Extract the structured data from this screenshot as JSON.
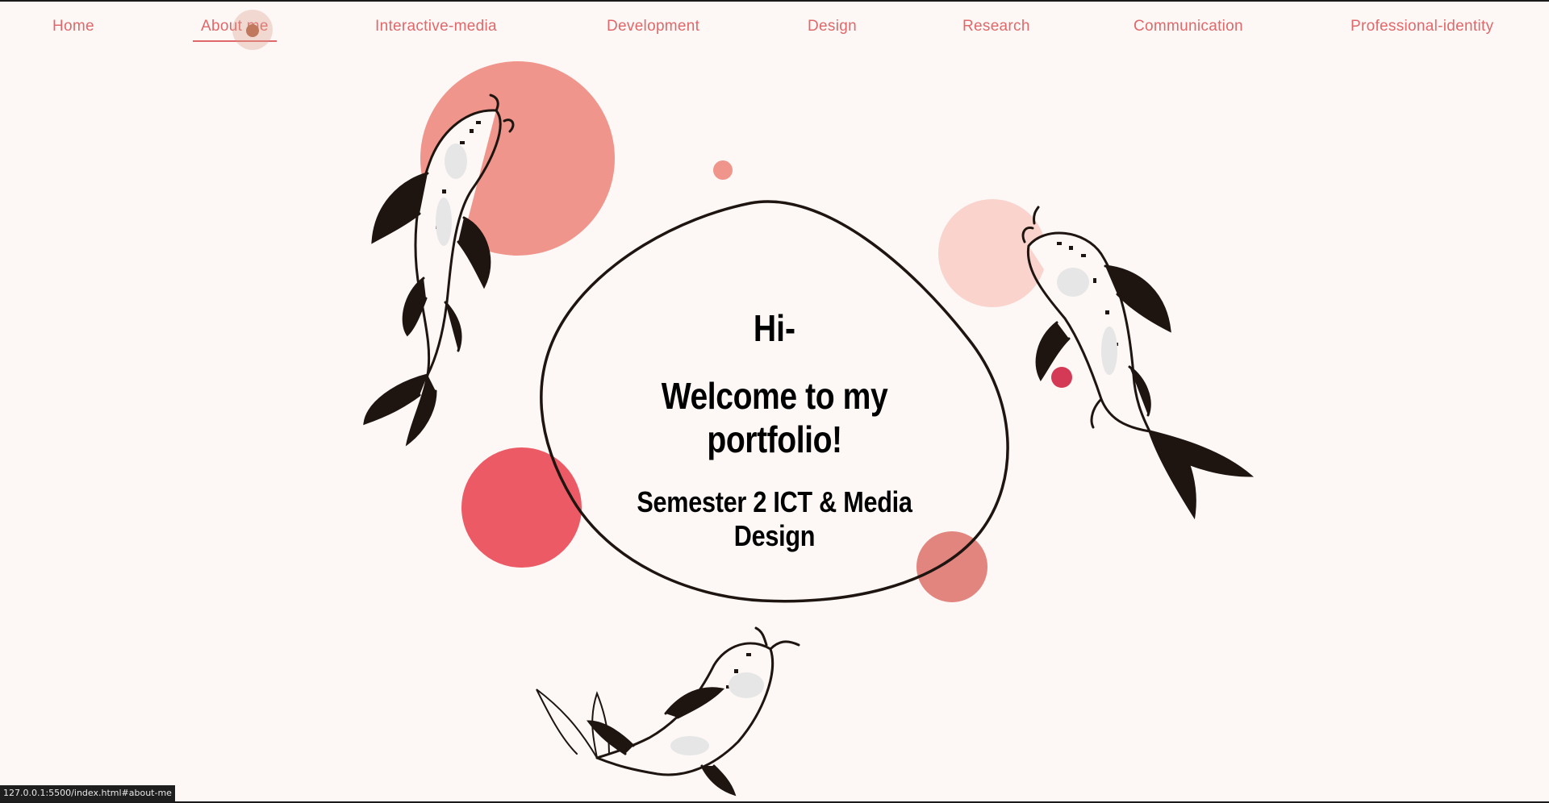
{
  "nav": {
    "items": [
      {
        "label": "Home"
      },
      {
        "label": "About me",
        "active": true
      },
      {
        "label": "Interactive-media"
      },
      {
        "label": "Development"
      },
      {
        "label": "Design"
      },
      {
        "label": "Research"
      },
      {
        "label": "Communication"
      },
      {
        "label": "Professional-identity"
      }
    ]
  },
  "hero": {
    "greeting": "Hi-",
    "welcome": "Welcome to my portfolio!",
    "subtitle": "Semester 2 ICT & Media Design"
  },
  "status_bar": {
    "url": "127.0.0.1:5500/index.html#about-me"
  },
  "colors": {
    "background": "#fdf8f6",
    "nav_text": "#e0686a",
    "circle_salmon": "#f0958c",
    "circle_pale": "#f9d3cc",
    "circle_red": "#ec5b65",
    "circle_rose": "#e2857f",
    "fish_ink": "#1e1410"
  },
  "icons": [
    "koi-fish-illustration",
    "decorative-circle",
    "outline-blob"
  ]
}
